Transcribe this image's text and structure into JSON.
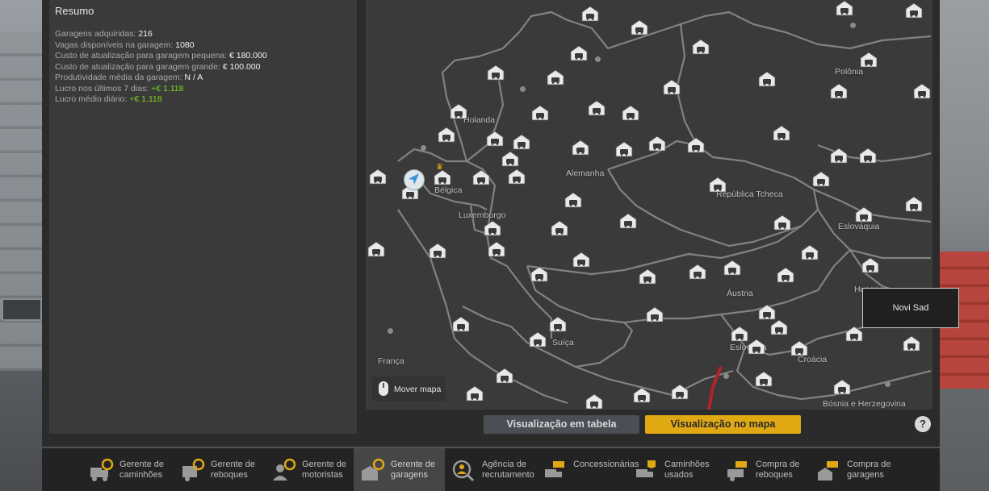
{
  "summary": {
    "title": "Resumo",
    "stats": [
      {
        "label": "Garagens adquiridas:",
        "value": "216"
      },
      {
        "label": "Vagas disponíveis na garagem:",
        "value": "1080"
      },
      {
        "label": "Custo de atualização para garagem pequena:",
        "value": "€ 180.000"
      },
      {
        "label": "Custo de atualização para garagem grande:",
        "value": "€ 100.000"
      },
      {
        "label": "Produtividade média da garagem:",
        "value": "N / A"
      },
      {
        "label": "Lucro nos últimos 7 dias:",
        "value": "+€ 1.118"
      },
      {
        "label": "Lucro médio diário:",
        "value": "+€ 1.118"
      }
    ]
  },
  "map": {
    "countries": [
      "Polônia",
      "Holanda",
      "Alemanha",
      "Bélgica",
      "República Tcheca",
      "Luxemburgo",
      "Eslováquia",
      "Áustria",
      "Hungria",
      "França",
      "Suíça",
      "Eslovênia",
      "Croácia",
      "Bósnia e Herzegovina"
    ],
    "move_map_label": "Mover mapa",
    "tooltip_city": "Novi Sad"
  },
  "view_toggle": {
    "table_label": "Visualização em tabela",
    "map_label": "Visualização no mapa",
    "help_label": "?"
  },
  "bottom_nav": [
    {
      "label": "Gerente de caminhões",
      "icon": "truck-manager-icon",
      "active": false
    },
    {
      "label": "Gerente de reboques",
      "icon": "trailer-manager-icon",
      "active": false
    },
    {
      "label": "Gerente de motoristas",
      "icon": "driver-manager-icon",
      "active": false
    },
    {
      "label": "Gerente de garagens",
      "icon": "garage-manager-icon",
      "active": true
    },
    {
      "label": "Agência de recrutamento",
      "icon": "recruitment-agency-icon",
      "active": false
    },
    {
      "label": "Concessionárias",
      "icon": "dealership-icon",
      "active": false
    },
    {
      "label": "Caminhões usados",
      "icon": "used-trucks-icon",
      "active": false
    },
    {
      "label": "Compra de reboques",
      "icon": "trailer-purchase-icon",
      "active": false
    },
    {
      "label": "Compra de garagens",
      "icon": "garage-purchase-icon",
      "active": false
    }
  ],
  "colors": {
    "accent": "#e0a813",
    "positive": "#7ed321",
    "panel": "#2b2b2b"
  }
}
